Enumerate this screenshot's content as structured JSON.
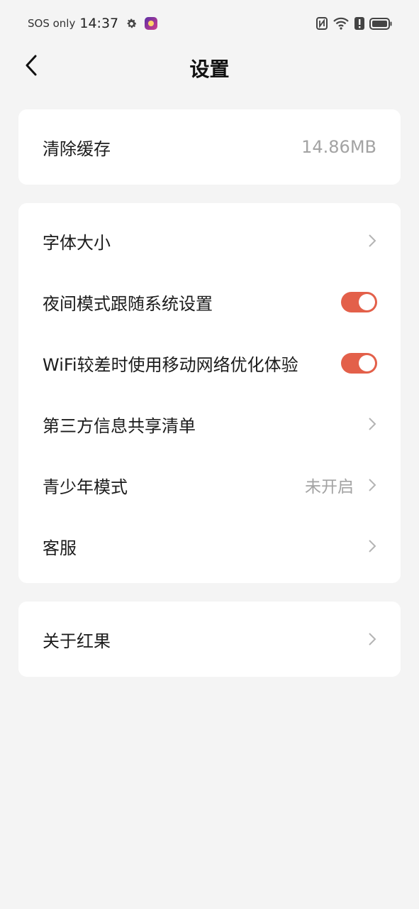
{
  "status_bar": {
    "carrier": "SOS only",
    "time": "14:37",
    "icons": [
      "gear-icon",
      "app-icon",
      "nfc-icon",
      "wifi-icon",
      "alert-icon",
      "battery-icon"
    ]
  },
  "header": {
    "title": "设置"
  },
  "cache": {
    "label": "清除缓存",
    "value": "14.86MB"
  },
  "settings": {
    "font_size": {
      "label": "字体大小"
    },
    "night_mode": {
      "label": "夜间模式跟随系统设置",
      "on": true
    },
    "wifi_optimize": {
      "label": "WiFi较差时使用移动网络优化体验",
      "on": true
    },
    "third_party": {
      "label": "第三方信息共享清单"
    },
    "teen_mode": {
      "label": "青少年模式",
      "value": "未开启"
    },
    "customer_service": {
      "label": "客服"
    }
  },
  "about": {
    "label": "关于红果"
  },
  "colors": {
    "background": "#f4f4f4",
    "card": "#ffffff",
    "toggle_on": "#e3604a",
    "secondary_text": "#a3a3a3"
  }
}
